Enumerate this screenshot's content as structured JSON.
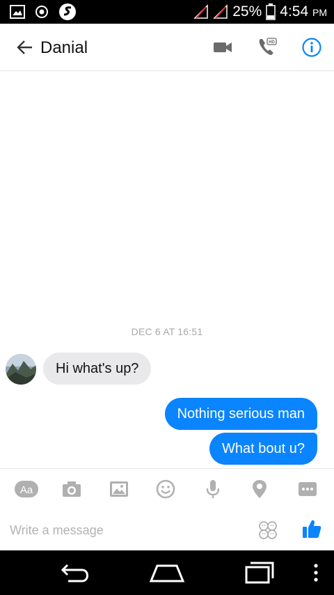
{
  "status_bar": {
    "battery_percent": "25%",
    "time": "4:54",
    "ampm": "PM"
  },
  "header": {
    "contact_name": "Danial",
    "icons": [
      "back-arrow-icon",
      "video-call-icon",
      "hd-phone-icon",
      "info-icon"
    ]
  },
  "conversation": {
    "date_separator": "DEC 6 AT 16:51",
    "messages": [
      {
        "direction": "incoming",
        "text": "Hi what's up?"
      },
      {
        "direction": "outgoing",
        "text": "Nothing serious man"
      },
      {
        "direction": "outgoing",
        "text": "What bout u?"
      }
    ]
  },
  "composer": {
    "text_format_label": "Aa",
    "toolbar_icons": [
      "text-format-icon",
      "camera-icon",
      "gallery-icon",
      "emoji-icon",
      "microphone-icon",
      "location-icon",
      "more-icon"
    ],
    "placeholder": "Write a message",
    "value": "",
    "action_icons": [
      "stickers-icon",
      "like-thumb-icon"
    ]
  },
  "colors": {
    "accent": "#0b84ff",
    "incoming_bubble": "#e9e9eb",
    "icon_gray": "#b0b0b0"
  }
}
